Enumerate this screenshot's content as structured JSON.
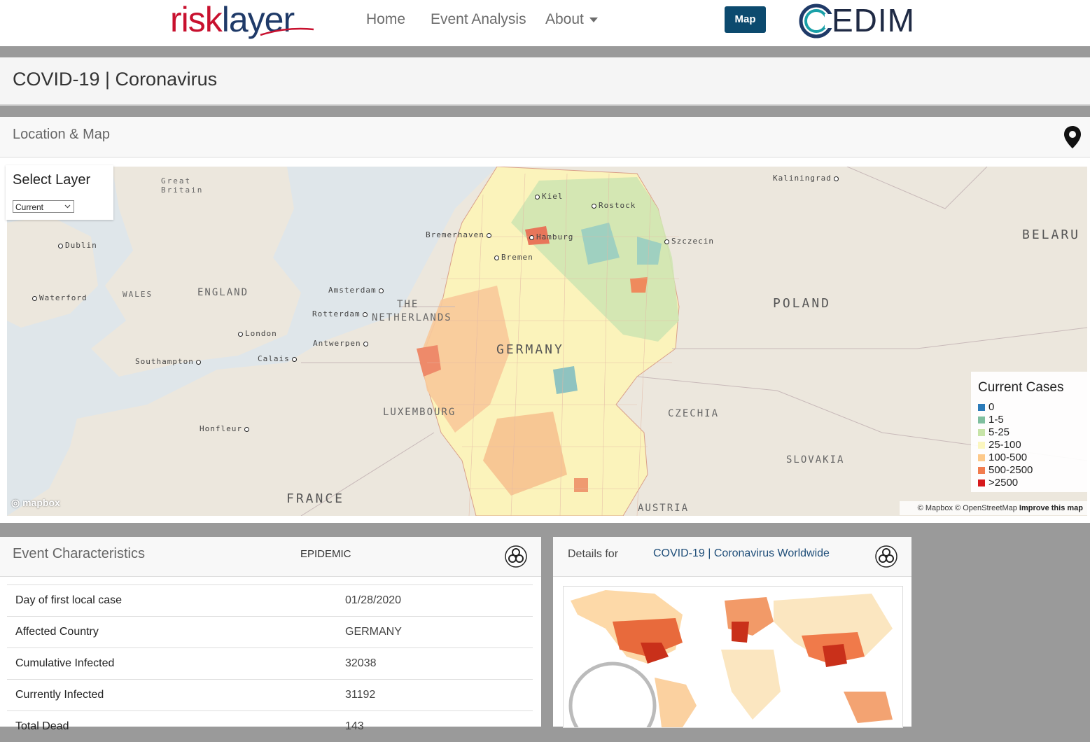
{
  "nav": {
    "logo_risk": "risk",
    "logo_layer": "layer",
    "home": "Home",
    "event_analysis": "Event Analysis",
    "about": "About",
    "map_button": "Map",
    "partner_logo": "EDIM"
  },
  "page": {
    "title": "COVID-19 | Coronavirus"
  },
  "location": {
    "header": "Location & Map",
    "select_layer_title": "Select Layer",
    "select_layer_value": "Current",
    "map_labels": {
      "great_britain": "Great\nBritain",
      "dublin": "Dublin",
      "waterford": "Waterford",
      "wales": "WALES",
      "england": "ENGLAND",
      "london": "London",
      "southampton": "Southampton",
      "calais": "Calais",
      "honfleur": "Honfleur",
      "france": "FRANCE",
      "amsterdam": "Amsterdam",
      "rotterdam": "Rotterdam",
      "the": "THE",
      "netherlands": "NETHERLANDS",
      "antwerpen": "Antwerpen",
      "luxembourg": "LUXEMBOURG",
      "bremerhaven": "Bremerhaven",
      "bremen": "Bremen",
      "hamburg": "Hamburg",
      "kiel": "Kiel",
      "rostock": "Rostock",
      "germany": "GERMANY",
      "szczecin": "Szczecin",
      "kaliningrad": "Kaliningrad",
      "belarus": "BELARU",
      "poland": "POLAND",
      "czechia": "CZECHIA",
      "slovakia": "SLOVAKIA",
      "austria": "AUSTRIA"
    },
    "legend": {
      "title": "Current Cases",
      "items": [
        {
          "label": "0",
          "color": "#2b7bb9"
        },
        {
          "label": "1-5",
          "color": "#7fbf9f"
        },
        {
          "label": "5-25",
          "color": "#c7e4a8"
        },
        {
          "label": "25-100",
          "color": "#fbf6bf"
        },
        {
          "label": "100-500",
          "color": "#fdc98a"
        },
        {
          "label": "500-2500",
          "color": "#f27c4e"
        },
        {
          "label": ">2500",
          "color": "#d7191c"
        }
      ]
    },
    "attribution_mapbox": "© Mapbox",
    "attribution_osm": "© OpenStreetMap",
    "attribution_improve": "Improve this map",
    "mapbox_logo": "mapbox"
  },
  "event": {
    "header": "Event Characteristics",
    "type": "EPIDEMIC",
    "rows": [
      {
        "key": "Day of first local case",
        "value": "01/28/2020"
      },
      {
        "key": "Affected Country",
        "value": "GERMANY"
      },
      {
        "key": "Cumulative Infected",
        "value": "32038"
      },
      {
        "key": "Currently Infected",
        "value": "31192"
      },
      {
        "key": "Total Dead",
        "value": "143"
      }
    ]
  },
  "details": {
    "label": "Details for",
    "link": "COVID-19 | Coronavirus Worldwide"
  }
}
